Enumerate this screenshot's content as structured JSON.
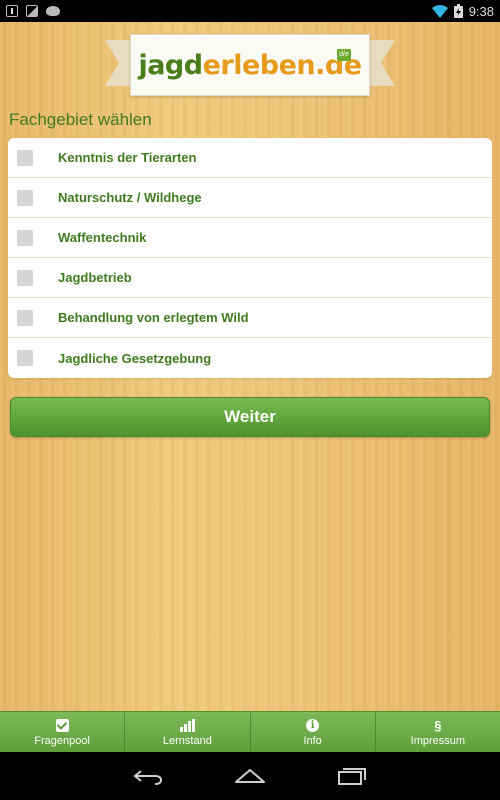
{
  "status_bar": {
    "time": "9:38",
    "icons": [
      "download-icon",
      "image-icon",
      "android-icon",
      "wifi-icon",
      "battery-charging-icon"
    ]
  },
  "logo": {
    "part1": "jagd",
    "part2": "erleben.de",
    "badge": "d/e"
  },
  "section_title": "Fachgebiet wählen",
  "topics": [
    {
      "label": "Kenntnis der Tierarten",
      "checked": false
    },
    {
      "label": "Naturschutz / Wildhege",
      "checked": false
    },
    {
      "label": "Waffentechnik",
      "checked": false
    },
    {
      "label": "Jagdbetrieb",
      "checked": false
    },
    {
      "label": "Behandlung von erlegtem Wild",
      "checked": false
    },
    {
      "label": "Jagdliche Gesetzgebung",
      "checked": false
    }
  ],
  "continue_label": "Weiter",
  "tabs": [
    {
      "label": "Fragenpool",
      "icon": "checkbox-icon"
    },
    {
      "label": "Lernstand",
      "icon": "bar-chart-icon"
    },
    {
      "label": "Info",
      "icon": "info-icon"
    },
    {
      "label": "Impressum",
      "icon": "paragraph-icon",
      "glyph": "§"
    }
  ],
  "navbar": {
    "icons": [
      "back-icon",
      "home-icon",
      "recent-apps-icon"
    ]
  },
  "colors": {
    "brand_green": "#3f7b1f",
    "brand_orange": "#e79b1d",
    "button_green": "#5fa53a",
    "wood": "#f0c97a"
  }
}
